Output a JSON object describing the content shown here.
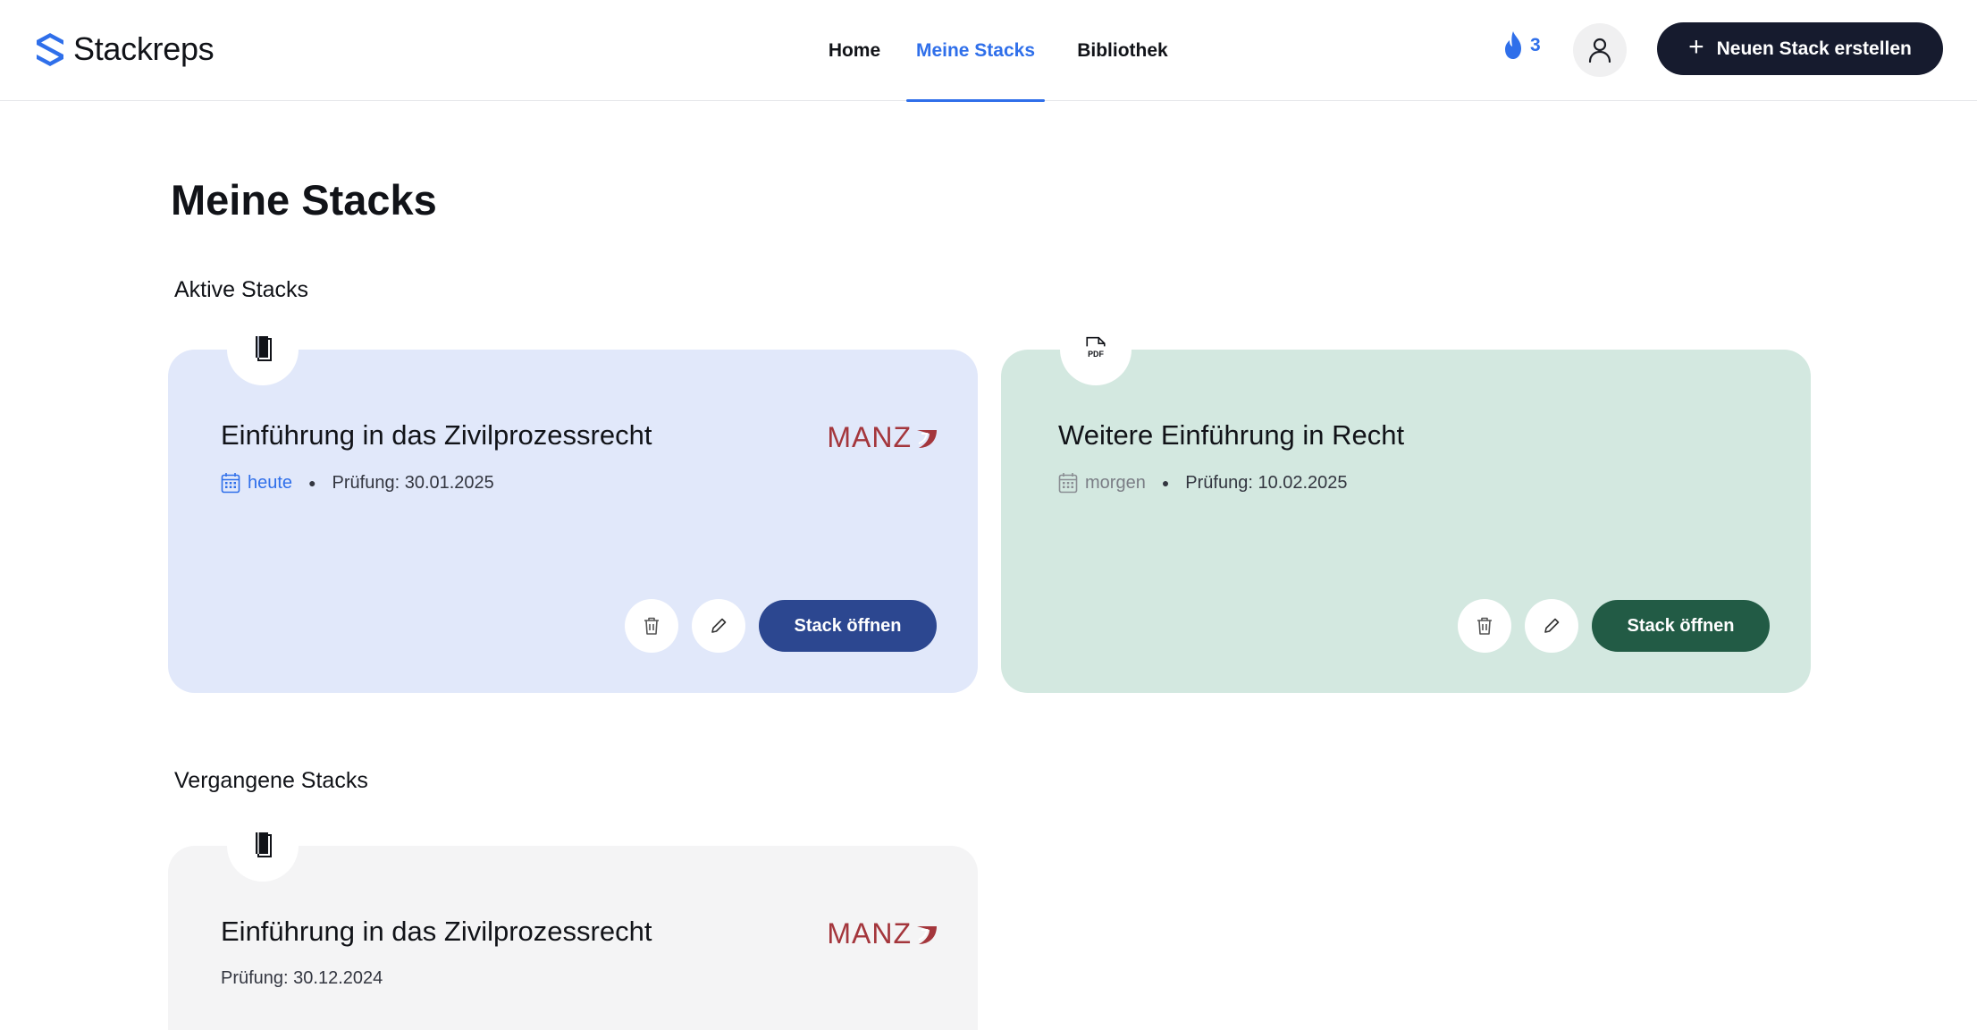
{
  "app": {
    "name": "Stackreps",
    "accent": "#2f6fea"
  },
  "nav": {
    "items": [
      {
        "label": "Home",
        "active": false
      },
      {
        "label": "Meine Stacks",
        "active": true
      },
      {
        "label": "Bibliothek",
        "active": false
      }
    ]
  },
  "header": {
    "streak_icon": "flame-icon",
    "streak_count": "3",
    "profile_icon": "user-icon",
    "create_button_label": "Neuen Stack erstellen"
  },
  "page": {
    "title": "Meine Stacks",
    "active_section_title": "Aktive Stacks",
    "past_section_title": "Vergangene Stacks"
  },
  "active_stacks": [
    {
      "title": "Einführung in das Zivilprozessrecht",
      "type_icon": "book-icon",
      "publisher_logo": "MANZ",
      "due_label": "heute",
      "exam_label": "Prüfung: 30.01.2025",
      "open_label": "Stack öffnen",
      "color": "#e1e8fa",
      "button_color": "#2c4790"
    },
    {
      "title": "Weitere Einführung in Recht",
      "type_icon": "pdf-file-icon",
      "due_label": "morgen",
      "exam_label": "Prüfung: 10.02.2025",
      "open_label": "Stack öffnen",
      "color": "#d3e8e0",
      "button_color": "#225b45"
    }
  ],
  "past_stacks": [
    {
      "title": "Einführung in das Zivilprozessrecht",
      "type_icon": "book-icon",
      "publisher_logo": "MANZ",
      "exam_label": "Prüfung: 30.12.2024",
      "color": "#f4f4f5"
    }
  ]
}
